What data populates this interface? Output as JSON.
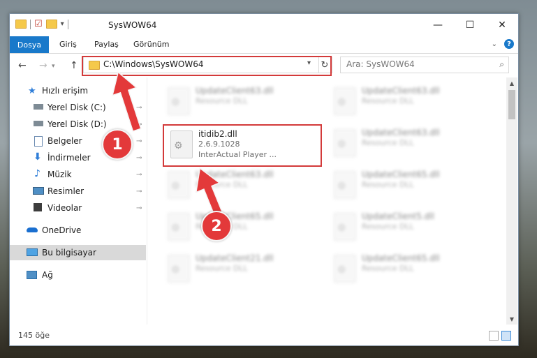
{
  "window": {
    "title": "SysWOW64",
    "controls": {
      "minimize": "—",
      "maximize": "☐",
      "close": "✕"
    }
  },
  "ribbon": {
    "file_tab": "Dosya",
    "tabs": [
      "Giriş",
      "Paylaş",
      "Görünüm"
    ],
    "expand_icon": "chevron-down-icon",
    "help_label": "?"
  },
  "navigation": {
    "back_label": "←",
    "forward_label": "→",
    "up_label": "↑",
    "address": "C:\\Windows\\SysWOW64",
    "refresh_label": "↻",
    "search_placeholder": "Ara: SysWOW64"
  },
  "sidebar": {
    "items": [
      {
        "label": "Hızlı erişim",
        "icon": "star-icon",
        "pinned": false
      },
      {
        "label": "Yerel Disk (C:)",
        "icon": "drive-icon",
        "pinned": true
      },
      {
        "label": "Yerel Disk (D:)",
        "icon": "drive-icon",
        "pinned": true
      },
      {
        "label": "Belgeler",
        "icon": "document-icon",
        "pinned": true
      },
      {
        "label": "İndirmeler",
        "icon": "download-icon",
        "pinned": true
      },
      {
        "label": "Müzik",
        "icon": "music-icon",
        "pinned": true
      },
      {
        "label": "Resimler",
        "icon": "pictures-icon",
        "pinned": true
      },
      {
        "label": "Videolar",
        "icon": "video-icon",
        "pinned": true
      },
      {
        "label": "OneDrive",
        "icon": "cloud-icon",
        "pinned": false
      },
      {
        "label": "Bu bilgisayar",
        "icon": "computer-icon",
        "pinned": false,
        "selected": true
      },
      {
        "label": "Ağ",
        "icon": "network-icon",
        "pinned": false
      }
    ],
    "pin_glyph": "📌"
  },
  "files": {
    "highlighted": {
      "name": "itidib2.dll",
      "version": "2.6.9.1028",
      "description": "InterActual Player ..."
    },
    "blurred": [
      {
        "name": "UpdateClient63.dll",
        "type": "Resource DLL"
      },
      {
        "name": "UpdateClient63.dll",
        "type": "Resource DLL"
      },
      {
        "name": "UpdateClient63.dll",
        "type": "Resource DLL"
      },
      {
        "name": "UpdateClient63.dll",
        "type": "Resource DLL"
      },
      {
        "name": "UpdateClient65.dll",
        "type": "Resource DLL"
      },
      {
        "name": "UpdateClient65.dll",
        "type": "Resource DLL"
      },
      {
        "name": "UpdateClient65.dll",
        "type": "Resource DLL"
      },
      {
        "name": "UpdateClient5.dll",
        "type": "Resource DLL"
      },
      {
        "name": "UpdateClient21.dll",
        "type": "Resource DLL"
      },
      {
        "name": "UpdateClient65.dll",
        "type": "Resource DLL"
      }
    ]
  },
  "status": {
    "item_count": "145 öğe"
  },
  "annotations": {
    "step1": "1",
    "step2": "2",
    "color": "#e3393a"
  }
}
